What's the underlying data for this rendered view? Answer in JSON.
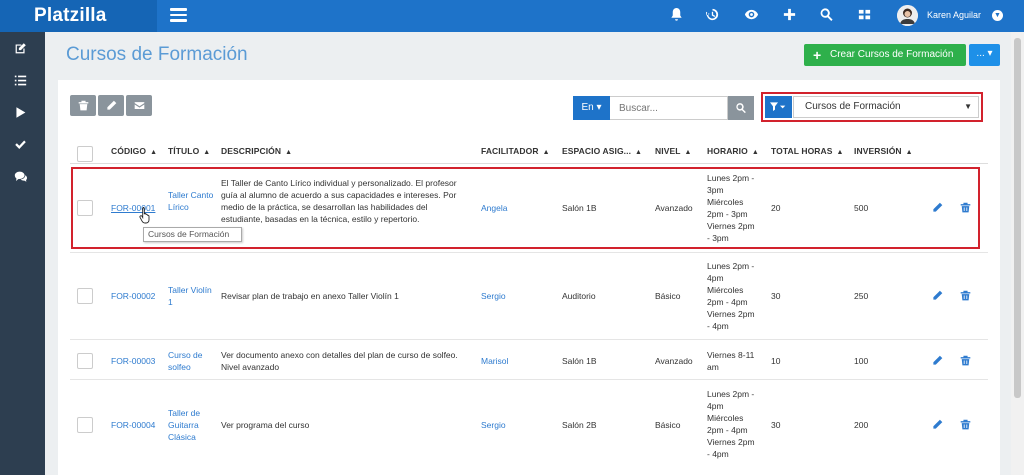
{
  "app": {
    "logo": "Platzilla"
  },
  "user": {
    "name": "Karen Aguilar"
  },
  "page": {
    "title": "Cursos de Formación"
  },
  "actions": {
    "create_label": "Crear Cursos de Formación",
    "more_label": "... ▾"
  },
  "search": {
    "lang": "En ▾",
    "placeholder": "Buscar..."
  },
  "filter": {
    "selected": "Cursos de Formación"
  },
  "table": {
    "columns": [
      "CÓDIGO",
      "TÍTULO",
      "DESCRIPCIÓN",
      "FACILITADOR",
      "ESPACIO ASIG...",
      "NIVEL",
      "HORARIO",
      "TOTAL HORAS",
      "INVERSIÓN"
    ],
    "rows": [
      {
        "code": "FOR-00001",
        "title": "Taller Canto Lírico",
        "description": "El Taller de Canto Lírico individual y personalizado. El profesor guía al alumno de acuerdo a sus capacidades e intereses. Por medio de la práctica, se desarrollan las habilidades del estudiante, basadas en la técnica, estilo y repertorio.",
        "facilitator": "Angela",
        "space": "Salón 1B",
        "level": "Avanzado",
        "schedule": [
          "Lunes 2pm -",
          "3pm",
          "Miércoles",
          "2pm - 3pm",
          "Viernes 2pm",
          "- 3pm"
        ],
        "hours": "20",
        "investment": "500"
      },
      {
        "code": "FOR-00002",
        "title": "Taller Violín 1",
        "description": "Revisar plan de trabajo en anexo Taller Violín 1",
        "facilitator": "Sergio",
        "space": "Auditorio",
        "level": "Básico",
        "schedule": [
          "Lunes 2pm -",
          "4pm",
          "Miércoles",
          "2pm - 4pm",
          "Viernes 2pm",
          "- 4pm"
        ],
        "hours": "30",
        "investment": "250"
      },
      {
        "code": "FOR-00003",
        "title": "Curso de solfeo",
        "description": "Ver documento anexo con detalles del plan de curso de solfeo. Nivel avanzado",
        "facilitator": "Marisol",
        "space": "Salón 1B",
        "level": "Avanzado",
        "schedule": [
          "Viernes 8-11",
          "am"
        ],
        "hours": "10",
        "investment": "100"
      },
      {
        "code": "FOR-00004",
        "title": "Taller de Guitarra Clásica",
        "description": "Ver programa del curso",
        "facilitator": "Sergio",
        "space": "Salón 2B",
        "level": "Básico",
        "schedule": [
          "Lunes 2pm -",
          "4pm",
          "Miércoles",
          "2pm - 4pm",
          "Viernes 2pm",
          "- 4pm"
        ],
        "hours": "30",
        "investment": "200"
      }
    ]
  },
  "tooltip": {
    "text": "Cursos de Formación"
  }
}
